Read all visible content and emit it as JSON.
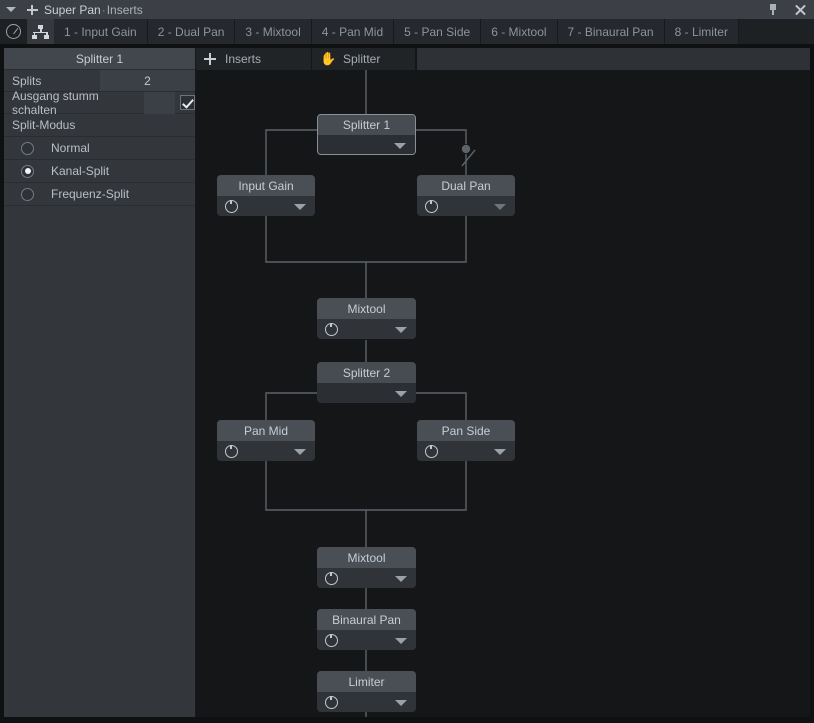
{
  "titlebar": {
    "caret_icon": "triangle-down-icon",
    "plus_icon": "plus-icon",
    "title": "Super Pan",
    "separator": "·",
    "subtitle": "Inserts",
    "pin_icon": "pin-icon",
    "close_icon": "close-icon"
  },
  "toolbar": {
    "knob_icon": "knob-bypass-icon",
    "split_icon": "split-tree-icon",
    "tabs": [
      {
        "label": "1 - Input Gain"
      },
      {
        "label": "2 - Dual Pan"
      },
      {
        "label": "3 - Mixtool"
      },
      {
        "label": "4 - Pan Mid"
      },
      {
        "label": "5 - Pan Side"
      },
      {
        "label": "6 - Mixtool"
      },
      {
        "label": "7 - Binaural Pan"
      },
      {
        "label": "8 - Limiter"
      }
    ]
  },
  "sidebar": {
    "header": "Splitter 1",
    "splits": {
      "label": "Splits",
      "value": "2"
    },
    "mute_output": {
      "label": "Ausgang stumm schalten",
      "checked": true
    },
    "split_mode": {
      "label": "Split-Modus",
      "options": [
        {
          "label": "Normal",
          "selected": false
        },
        {
          "label": "Kanal-Split",
          "selected": true
        },
        {
          "label": "Frequenz-Split",
          "selected": false
        }
      ]
    }
  },
  "canvas": {
    "tabs": [
      {
        "label": "Inserts",
        "icon": "plus-icon"
      },
      {
        "label": "Splitter",
        "icon": "hand-icon",
        "glyph": "✋"
      }
    ],
    "nodes": [
      {
        "name": "Splitter 1",
        "type": "splitter",
        "selected": true,
        "power": false,
        "caret": true
      },
      {
        "name": "Input Gain",
        "type": "plugin",
        "selected": false,
        "power": true,
        "caret": true
      },
      {
        "name": "Dual Pan",
        "type": "plugin",
        "selected": false,
        "power": true,
        "caret": true
      },
      {
        "name": "Mixtool",
        "type": "plugin",
        "selected": false,
        "power": true,
        "caret": true
      },
      {
        "name": "Splitter 2",
        "type": "splitter",
        "selected": false,
        "power": false,
        "caret": true
      },
      {
        "name": "Pan Mid",
        "type": "plugin",
        "selected": false,
        "power": true,
        "caret": true
      },
      {
        "name": "Pan Side",
        "type": "plugin",
        "selected": false,
        "power": true,
        "caret": true
      },
      {
        "name": "Mixtool",
        "type": "plugin",
        "selected": false,
        "power": true,
        "caret": true
      },
      {
        "name": "Binaural Pan",
        "type": "plugin",
        "selected": false,
        "power": true,
        "caret": true
      },
      {
        "name": "Limiter",
        "type": "plugin",
        "selected": false,
        "power": true,
        "caret": true
      }
    ]
  },
  "colors": {
    "titlebar_bg": "#3c4046",
    "toolbar_bg": "#1e2124",
    "sidebar_bg": "#33373c",
    "canvas_bg": "#141617",
    "node_header": "#4a4f56",
    "node_body": "#303439",
    "wire": "#5d636a",
    "text": "#c7cdd4"
  }
}
